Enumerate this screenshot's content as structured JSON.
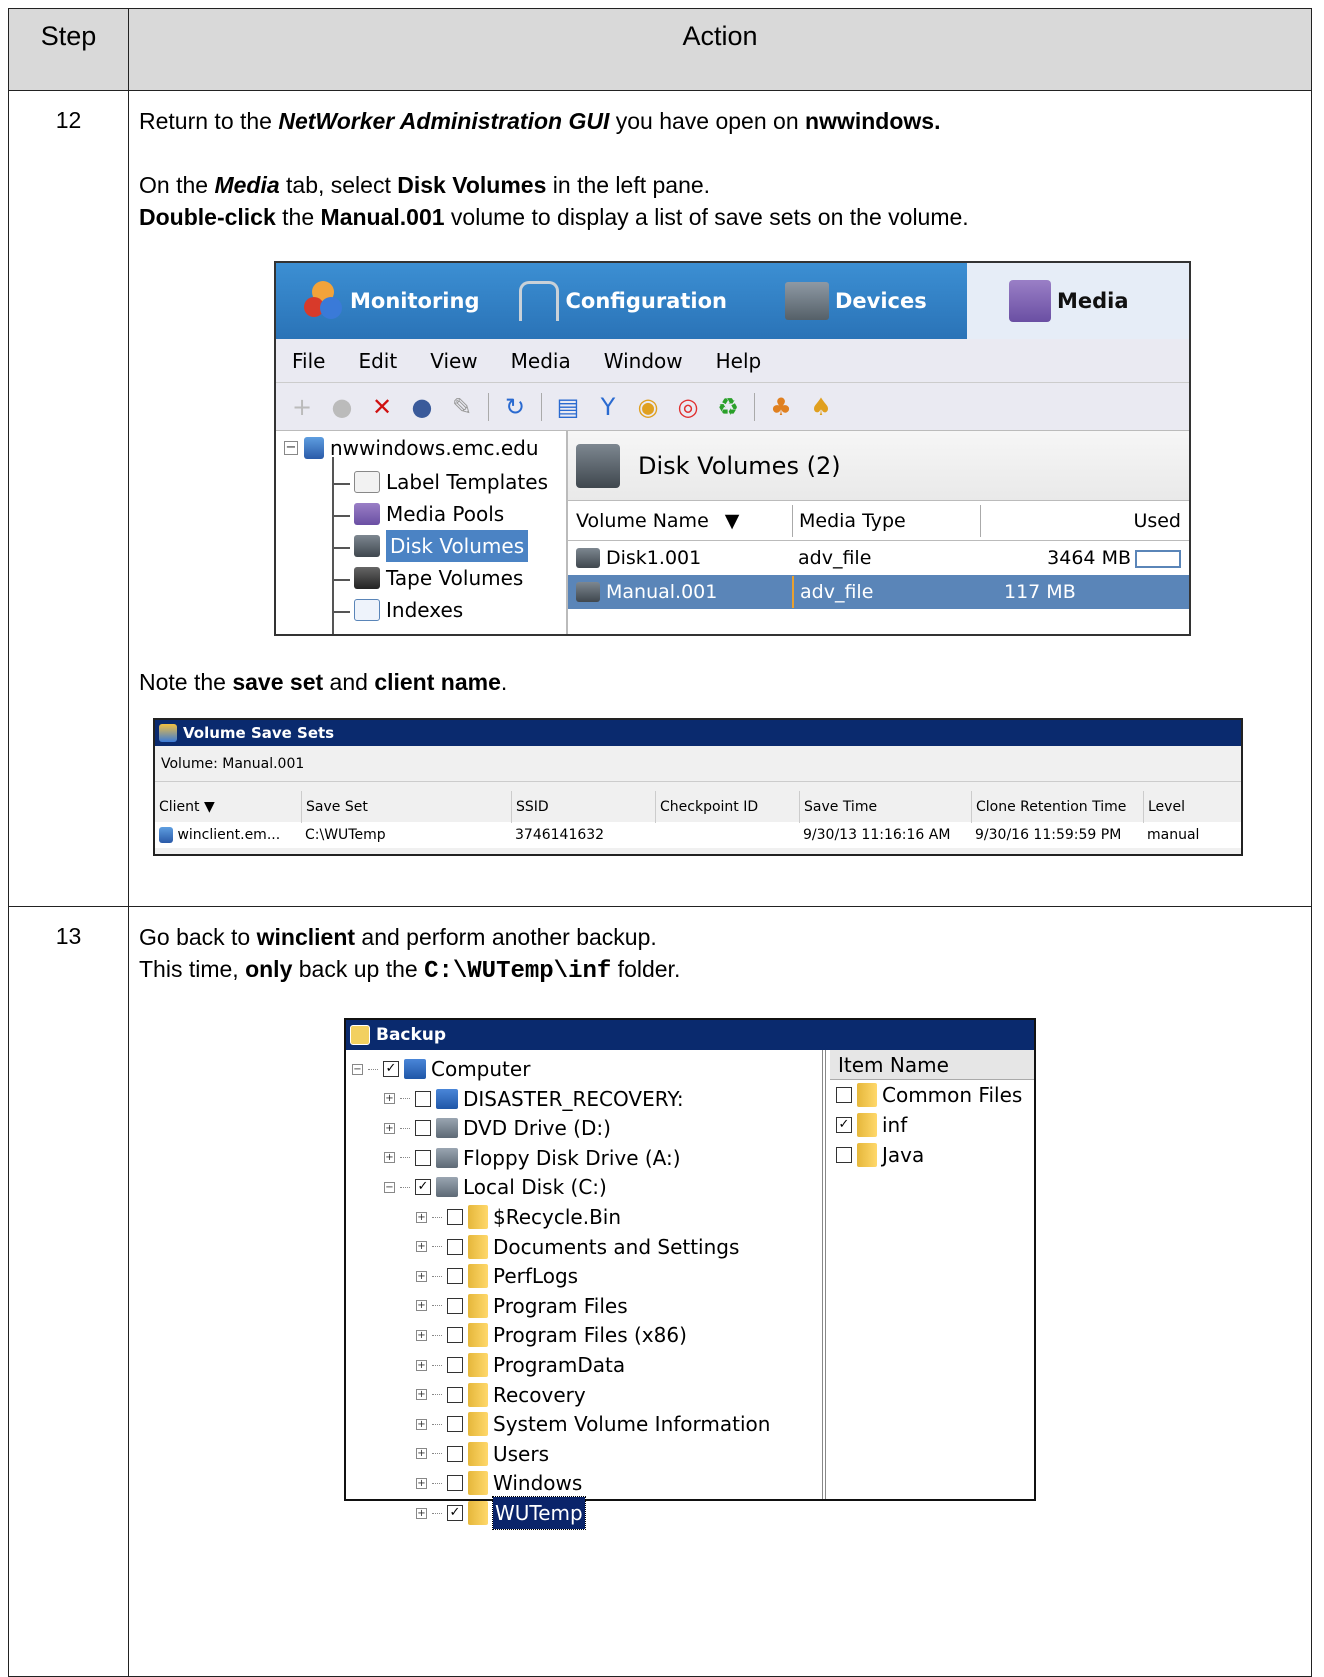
{
  "table": {
    "step_header": "Step",
    "action_header": "Action"
  },
  "step12": {
    "number": "12",
    "p1": {
      "a": "Return to the ",
      "b": "NetWorker Administration GUI",
      "c": " you have open on ",
      "d": "nwwindows."
    },
    "p2": {
      "a": "On the ",
      "b": "Media",
      "c": " tab, select ",
      "d": "Disk Volumes",
      "e": " in the left pane."
    },
    "p3": {
      "a": "Double-click",
      "b": " the ",
      "c": "Manual.001",
      "d": " volume to display a list of save sets on the volume."
    },
    "p4": {
      "a": "Note the ",
      "b": "save set",
      "c": " and ",
      "d": "client name",
      "e": "."
    }
  },
  "networker": {
    "tabs": [
      "Monitoring",
      "Configuration",
      "Devices",
      "Media"
    ],
    "menu": [
      "File",
      "Edit",
      "View",
      "Media",
      "Window",
      "Help"
    ],
    "tree": {
      "root": "nwwindows.emc.edu",
      "items": [
        "Label Templates",
        "Media Pools",
        "Disk Volumes",
        "Tape Volumes",
        "Indexes"
      ]
    },
    "panel_title": "Disk Volumes (2)",
    "columns": [
      "Volume Name",
      "Media Type",
      "Used"
    ],
    "rows": [
      {
        "name": "Disk1.001",
        "type": "adv_file",
        "used": "3464 MB"
      },
      {
        "name": "Manual.001",
        "type": "adv_file",
        "used": "117 MB"
      }
    ]
  },
  "vss": {
    "title": "Volume Save Sets",
    "volume_label": "Volume: Manual.001",
    "columns": [
      "Client",
      "Save Set",
      "SSID",
      "Checkpoint ID",
      "Save Time",
      "Clone Retention Time",
      "Level"
    ],
    "row": [
      "winclient.em...",
      "C:\\WUTemp",
      "3746141632",
      "",
      "9/30/13 11:16:16 AM",
      "9/30/16 11:59:59 PM",
      "manual"
    ]
  },
  "step13": {
    "number": "13",
    "p1": {
      "a": "Go back to ",
      "b": "winclient",
      "c": " and perform another backup."
    },
    "p2": {
      "a": "This time, ",
      "b": "only",
      "c": " back up the ",
      "d": "C:\\WUTemp\\inf",
      "e": " folder."
    }
  },
  "backup": {
    "title": "Backup",
    "tree": [
      {
        "label": "Computer",
        "checked": true
      },
      {
        "label": "DISASTER_RECOVERY:",
        "checked": false
      },
      {
        "label": "DVD Drive (D:)",
        "checked": false
      },
      {
        "label": "Floppy Disk Drive (A:)",
        "checked": false
      },
      {
        "label": "Local Disk (C:)",
        "checked": true
      },
      {
        "label": "$Recycle.Bin",
        "checked": false
      },
      {
        "label": "Documents and Settings",
        "checked": false
      },
      {
        "label": "PerfLogs",
        "checked": false
      },
      {
        "label": "Program Files",
        "checked": false
      },
      {
        "label": "Program Files (x86)",
        "checked": false
      },
      {
        "label": "ProgramData",
        "checked": false
      },
      {
        "label": "Recovery",
        "checked": false
      },
      {
        "label": "System Volume Information",
        "checked": false
      },
      {
        "label": "Users",
        "checked": false
      },
      {
        "label": "Windows",
        "checked": false
      },
      {
        "label": "WUTemp",
        "checked": true
      }
    ],
    "item_header": "Item Name",
    "items": [
      {
        "label": "Common Files",
        "checked": false
      },
      {
        "label": "inf",
        "checked": true
      },
      {
        "label": "Java",
        "checked": false
      }
    ]
  }
}
